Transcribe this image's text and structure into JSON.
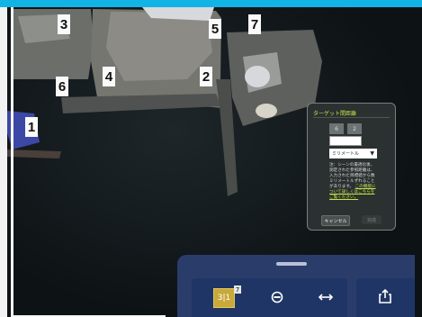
{
  "labels": [
    "1",
    "2",
    "3",
    "4",
    "5",
    "6",
    "7"
  ],
  "dialog": {
    "title": "ターゲット間距離",
    "field_a": "6",
    "field_b": "2",
    "distance_value": "",
    "unit_selected": "ミリメートル",
    "note_text": "注：シーンの最適化後、測定された参照距離は、入力された目標値から数ミリメートルずれることがあります。",
    "note_link": "この機能について詳しくはこちらをご覧ください。",
    "cancel_label": "キャンセル",
    "ok_label": "完成"
  },
  "toolbar": {
    "floor_label": "3|1",
    "floor_badge": "7",
    "icons": {
      "floor": "floor-plan-icon",
      "compass": "compass-icon",
      "measure": "double-arrow-icon",
      "share": "share-icon"
    }
  }
}
